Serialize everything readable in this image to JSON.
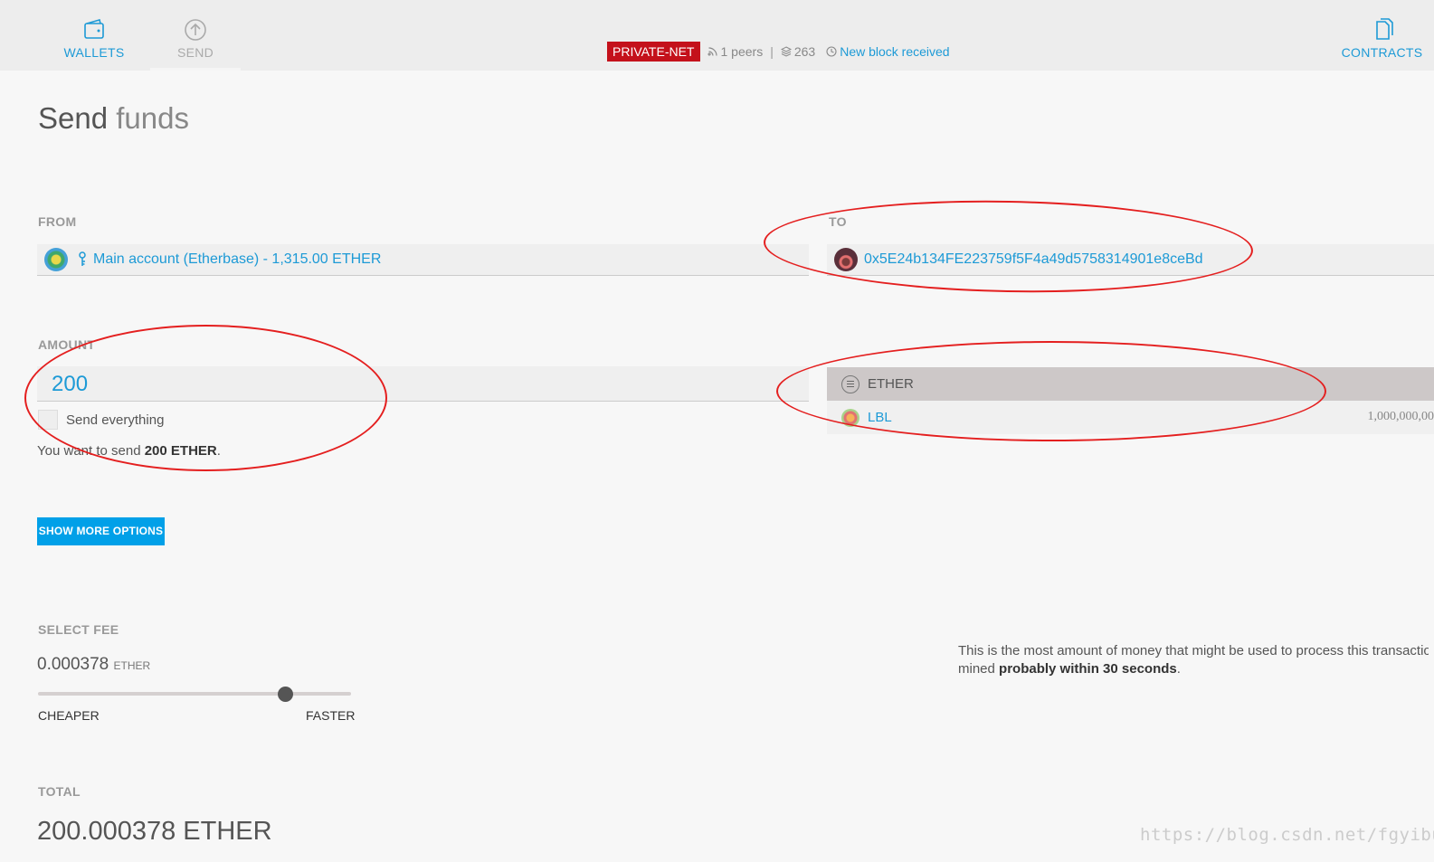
{
  "nav": {
    "wallets_label": "WALLETS",
    "send_label": "SEND",
    "contracts_label": "CONTRACTS"
  },
  "network": {
    "badge": "PRIVATE-NET",
    "peers": "1 peers",
    "separator": "|",
    "block_number": "263",
    "block_message": "New block received"
  },
  "page": {
    "title_strong": "Send",
    "title_light": "funds"
  },
  "from": {
    "label": "FROM",
    "account": "Main account (Etherbase) - 1,315.00 ETHER"
  },
  "to": {
    "label": "TO",
    "address": "0x5E24b134FE223759f5F4a49d5758314901e8ceBd"
  },
  "amount": {
    "label": "AMOUNT",
    "value": "200",
    "send_everything_label": "Send everything",
    "summary_prefix": "You want to send",
    "summary_amount": "200 ETHER",
    "summary_suffix": "."
  },
  "tokens": [
    {
      "name": "ETHER",
      "icon": "ether-icon",
      "balance": ""
    },
    {
      "name": "LBL",
      "icon": "lbl-token-icon",
      "balance": "1,000,000,00"
    }
  ],
  "options": {
    "show_more_label": "SHOW MORE OPTIONS"
  },
  "fee": {
    "label": "SELECT FEE",
    "value": "0.000378",
    "unit": "ETHER",
    "cheaper_label": "CHEAPER",
    "faster_label": "FASTER",
    "slider_level": 0.79,
    "note_line1": "This is the most amount of money that might be used to process this transaction",
    "note_line2_prefix": "mined",
    "note_line2_bold": "probably within 30 seconds",
    "note_line2_suffix": "."
  },
  "total": {
    "label": "TOTAL",
    "value": "200.000378 ETHER"
  },
  "watermark": "https://blog.csdn.net/fgyibupi",
  "colors": {
    "accent": "#1d9ad6",
    "badge": "#c4111b",
    "button": "#01a0e8",
    "annotation": "#e41f1f"
  }
}
